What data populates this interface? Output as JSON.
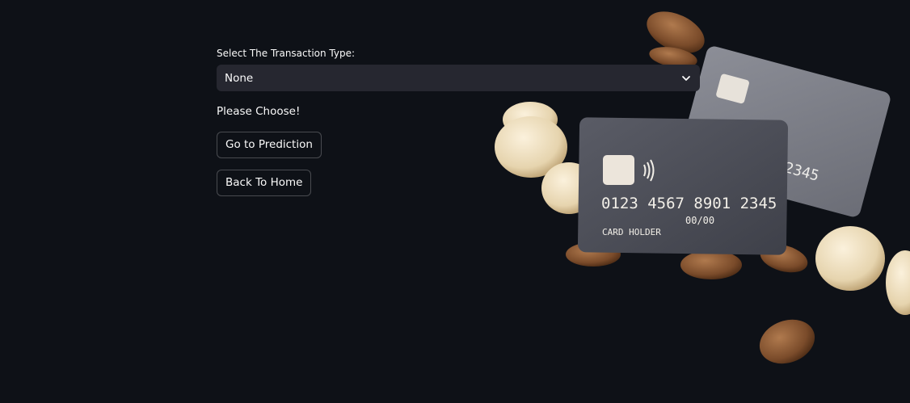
{
  "form": {
    "select_label": "Select The Transaction Type:",
    "select_value": "None",
    "prompt": "Please Choose!"
  },
  "buttons": {
    "prediction": "Go to Prediction",
    "home": "Back To Home"
  },
  "hero": {
    "card_number": "0123 4567 8901 2345",
    "card_number_back": "01 2345",
    "card_expiry": "00/00",
    "card_holder": "CARD HOLDER",
    "icons": [
      "credit-card-image",
      "coin-image",
      "chevron-down-icon",
      "contactless-icon"
    ]
  },
  "colors": {
    "background": "#0e1117",
    "select_bg": "#262730",
    "text": "#fafafa"
  }
}
